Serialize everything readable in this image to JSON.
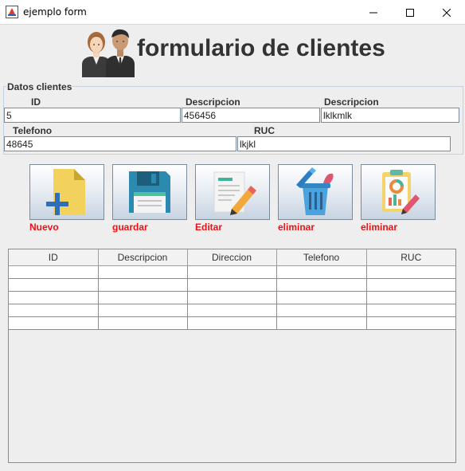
{
  "window": {
    "title": "ejemplo form"
  },
  "header": {
    "title": "formulario de clientes"
  },
  "form": {
    "legend": "Datos clientes",
    "labels": {
      "id": "ID",
      "descripcion1": "Descripcion",
      "descripcion2": "Descripcion",
      "telefono": "Telefono",
      "ruc": "RUC"
    },
    "values": {
      "id": "5",
      "descripcion1": "456456",
      "descripcion2": "lklkmlk",
      "telefono": "48645",
      "ruc": "lkjkl"
    }
  },
  "toolbar": {
    "nuevo": "Nuevo",
    "guardar": "guardar",
    "editar": "Editar",
    "eliminar": "eliminar",
    "eliminar2": "eliminar"
  },
  "table": {
    "columns": [
      "ID",
      "Descripcion",
      "Direccion",
      "Telefono",
      "RUC"
    ],
    "rows": [
      [
        "",
        "",
        "",
        "",
        ""
      ],
      [
        "",
        "",
        "",
        "",
        ""
      ],
      [
        "",
        "",
        "",
        "",
        ""
      ],
      [
        "",
        "",
        "",
        "",
        ""
      ],
      [
        "",
        "",
        "",
        "",
        ""
      ]
    ]
  },
  "colors": {
    "action_label": "#ee1111",
    "title": "#333333"
  },
  "icons": [
    "java-app-icon",
    "minimize-icon",
    "maximize-icon",
    "close-icon",
    "people-icon",
    "new-document-icon",
    "save-floppy-icon",
    "edit-document-icon",
    "trash-bin-icon",
    "clipboard-chart-icon"
  ]
}
